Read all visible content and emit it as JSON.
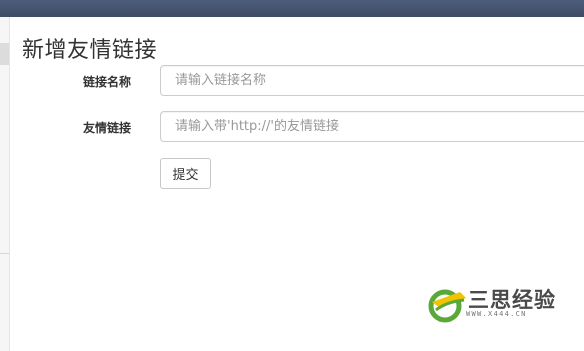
{
  "page": {
    "title": "新增友情链接"
  },
  "form": {
    "name_label": "链接名称",
    "name_placeholder": "请输入链接名称",
    "name_value": "",
    "url_label": "友情链接",
    "url_placeholder": "请输入带'http://'的友情链接",
    "url_value": "",
    "submit_label": "提交"
  },
  "watermark": {
    "title": "三思经验",
    "url": "WWW.X444.CN"
  },
  "colors": {
    "topbar": "#45536e",
    "input_border": "#cccccc",
    "placeholder": "#999999",
    "logo_green": "#5aa83a",
    "logo_yellow": "#f2c300"
  }
}
